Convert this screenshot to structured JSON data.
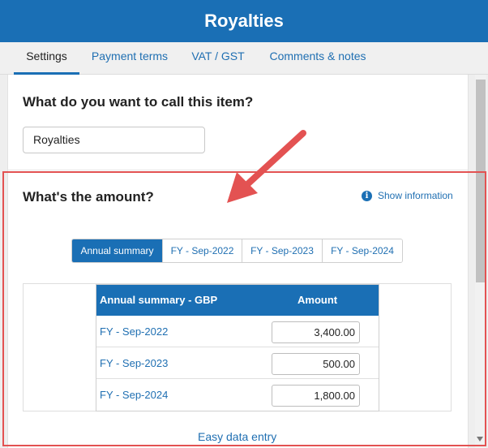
{
  "app": {
    "title": "Royalties"
  },
  "tabs": [
    {
      "label": "Settings",
      "active": true
    },
    {
      "label": "Payment terms",
      "active": false
    },
    {
      "label": "VAT / GST",
      "active": false
    },
    {
      "label": "Comments & notes",
      "active": false
    }
  ],
  "item_name": {
    "question": "What do you want to call this item?",
    "value": "Royalties"
  },
  "amount": {
    "question": "What's the amount?",
    "info_link": "Show information",
    "info_icon": "info-circle-icon",
    "segments": [
      {
        "label": "Annual summary",
        "active": true
      },
      {
        "label": "FY - Sep-2022",
        "active": false
      },
      {
        "label": "FY - Sep-2023",
        "active": false
      },
      {
        "label": "FY - Sep-2024",
        "active": false
      }
    ],
    "table": {
      "header_label": "Annual summary - GBP",
      "header_amount": "Amount",
      "rows": [
        {
          "label": "FY - Sep-2022",
          "value": "3,400.00"
        },
        {
          "label": "FY - Sep-2023",
          "value": "500.00"
        },
        {
          "label": "FY - Sep-2024",
          "value": "1,800.00"
        }
      ]
    },
    "easy_data_entry": "Easy data entry"
  },
  "colors": {
    "brand": "#1a6fb5",
    "link": "#1f6fb2",
    "highlight": "#e35252"
  }
}
